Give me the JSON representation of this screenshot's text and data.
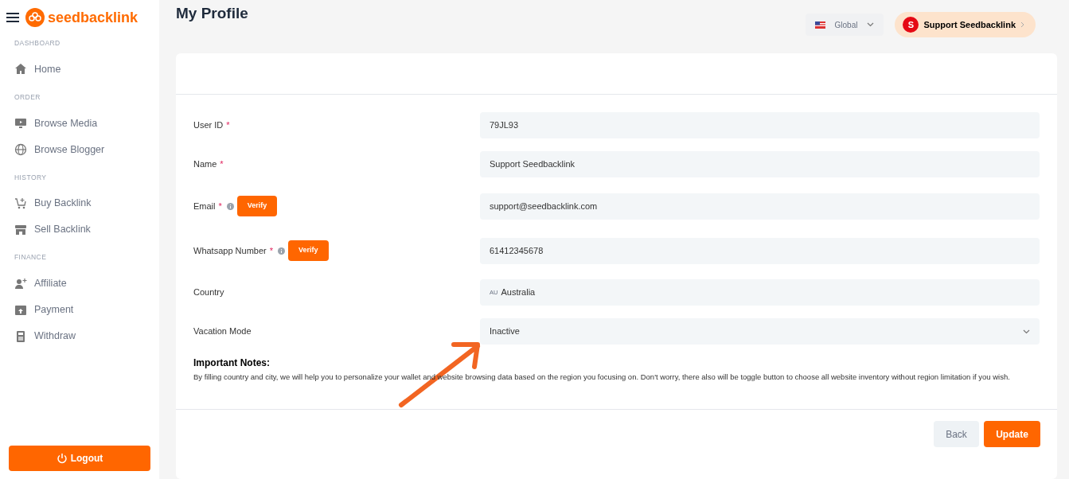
{
  "brand": {
    "name": "seedbacklink"
  },
  "sidebar": {
    "sections": [
      {
        "heading": "DASHBOARD",
        "items": [
          {
            "label": "Home"
          }
        ]
      },
      {
        "heading": "ORDER",
        "items": [
          {
            "label": "Browse Media"
          },
          {
            "label": "Browse Blogger"
          }
        ]
      },
      {
        "heading": "HISTORY",
        "items": [
          {
            "label": "Buy Backlink"
          },
          {
            "label": "Sell Backlink"
          }
        ]
      },
      {
        "heading": "FINANCE",
        "items": [
          {
            "label": "Affiliate"
          },
          {
            "label": "Payment"
          },
          {
            "label": "Withdraw"
          }
        ]
      }
    ],
    "logout": "Logout"
  },
  "header": {
    "title": "My Profile",
    "region": "Global",
    "user": {
      "initial": "S",
      "name": "Support Seedbacklink"
    }
  },
  "form": {
    "fields": [
      {
        "label": "User ID",
        "required_mark": "*",
        "value": "79JL93",
        "kind": "text"
      },
      {
        "label": "Name",
        "required_mark": "*",
        "value": "Support Seedbacklink",
        "kind": "text"
      },
      {
        "label": "Email",
        "required_mark": "*",
        "info": true,
        "verify": "Verify",
        "value": "support@seedbacklink.com",
        "kind": "text"
      },
      {
        "label": "Whatsapp Number",
        "required_mark": "*",
        "info": true,
        "verify": "Verify",
        "value": "61412345678",
        "kind": "text"
      },
      {
        "label": "Country",
        "value": "Australia",
        "code": "AU",
        "kind": "country"
      },
      {
        "label": "Vacation Mode",
        "value": "Inactive",
        "kind": "select"
      }
    ],
    "notes_title": "Important Notes:",
    "notes": "By filling country and city, we will help you to personalize your wallet and website browsing data based on the region you focusing on. Don't worry, there also will be toggle button to choose all website inventory without region limitation if you wish.",
    "buttons": {
      "back": "Back",
      "update": "Update"
    }
  }
}
